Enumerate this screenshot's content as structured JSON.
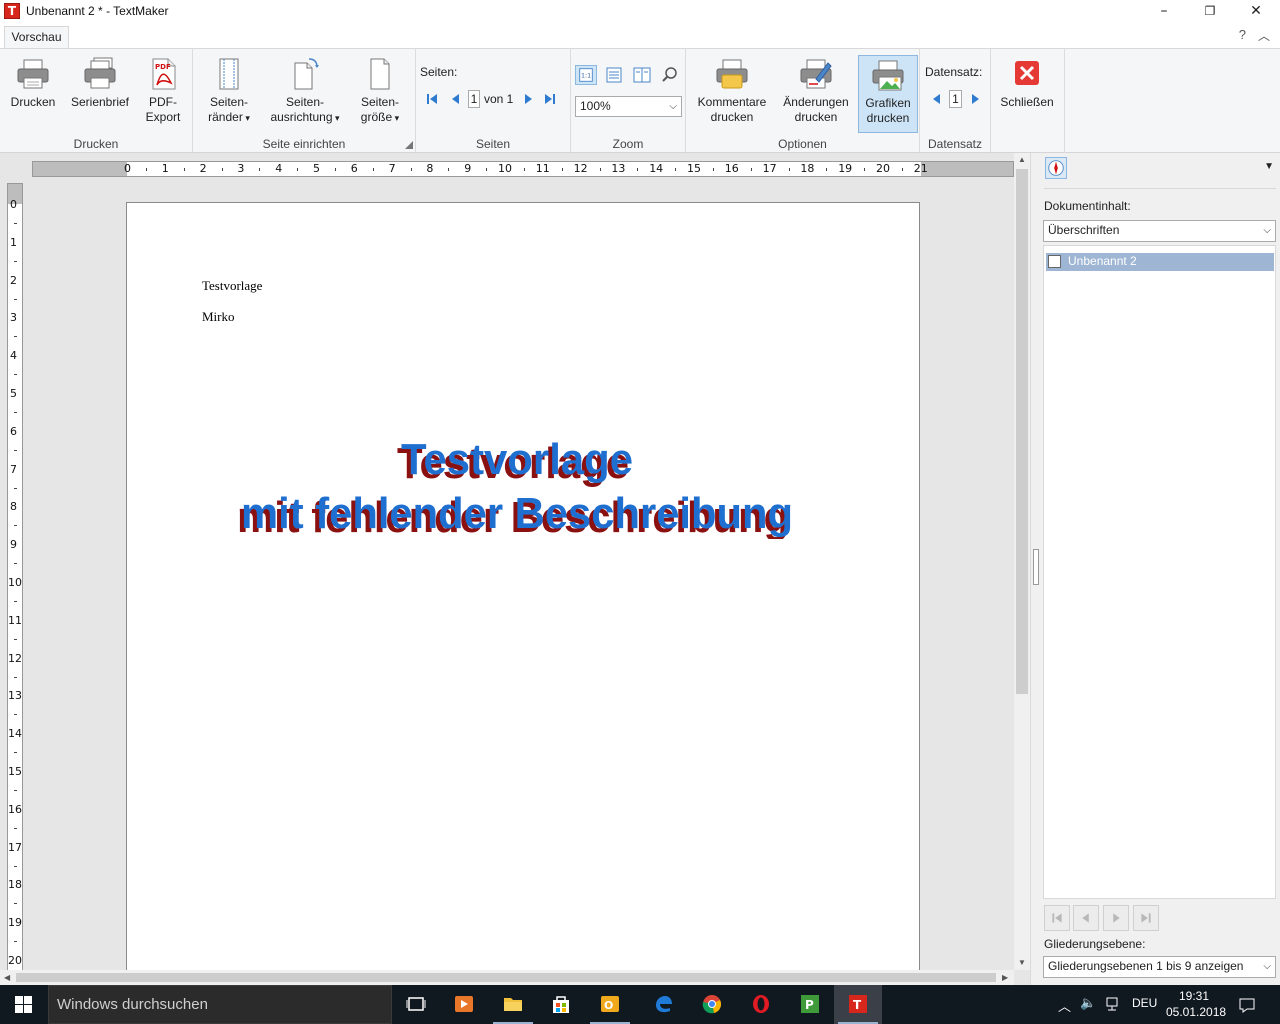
{
  "window": {
    "title": "Unbenannt 2 * - TextMaker",
    "app_icon_letter": "T",
    "controls": {
      "minimize": "–",
      "maximize": "❐",
      "close": "✕"
    }
  },
  "tabs": {
    "active": "Vorschau",
    "help": "?",
    "collapse": "︿"
  },
  "ribbon": {
    "drucken": {
      "label": "Drucken",
      "buttons": {
        "drucken": "Drucken",
        "serienbrief": "Serienbrief",
        "pdf_line1": "PDF-",
        "pdf_line2": "Export"
      }
    },
    "seite": {
      "label": "Seite einrichten",
      "raender_1": "Seiten-",
      "raender_2": "ränder",
      "ausrichtung_1": "Seiten-",
      "ausrichtung_2": "ausrichtung",
      "groesse_1": "Seiten-",
      "groesse_2": "größe"
    },
    "seiten": {
      "label": "Seiten",
      "seiten_label": "Seiten:",
      "current": "1",
      "of_text": "von 1"
    },
    "zoom": {
      "label": "Zoom",
      "value": "100%"
    },
    "optionen": {
      "label": "Optionen",
      "kommentare_1": "Kommentare",
      "kommentare_2": "drucken",
      "aenderungen_1": "Änderungen",
      "aenderungen_2": "drucken",
      "grafiken_1": "Grafiken",
      "grafiken_2": "drucken"
    },
    "datensatz": {
      "label": "Datensatz",
      "datensatz_label": "Datensatz:",
      "current": "1"
    },
    "schliessen": {
      "label": "Schließen"
    }
  },
  "ruler": {
    "horizontal": [
      "0",
      "1",
      "2",
      "3",
      "4",
      "5",
      "6",
      "7",
      "8",
      "9",
      "10",
      "11",
      "12",
      "13",
      "14",
      "15",
      "16",
      "17",
      "18",
      "19",
      "20",
      "21"
    ],
    "vertical": [
      "0",
      "1",
      "2",
      "3",
      "4",
      "5",
      "6",
      "7",
      "8",
      "9",
      "10",
      "11",
      "12",
      "13",
      "14",
      "15",
      "16",
      "17",
      "18",
      "19",
      "20"
    ]
  },
  "document": {
    "line1": "Testvorlage",
    "line2": "Mirko",
    "wordart_line1": "Testvorlage",
    "wordart_line2": "mit fehlender Beschreibung",
    "wordart_colors": {
      "fill": "#1e6fd0",
      "shadow": "#8b1010"
    }
  },
  "sidepanel": {
    "doc_content_label": "Dokumentinhalt:",
    "doc_content_value": "Überschriften",
    "outline_item": "Unbenannt 2",
    "gliederung_label": "Gliederungsebene:",
    "gliederung_value": "Gliederungsebenen 1 bis 9 anzeigen"
  },
  "taskbar": {
    "search_placeholder": "Windows durchsuchen",
    "language": "DEU",
    "time": "19:31",
    "date": "05.01.2018"
  }
}
